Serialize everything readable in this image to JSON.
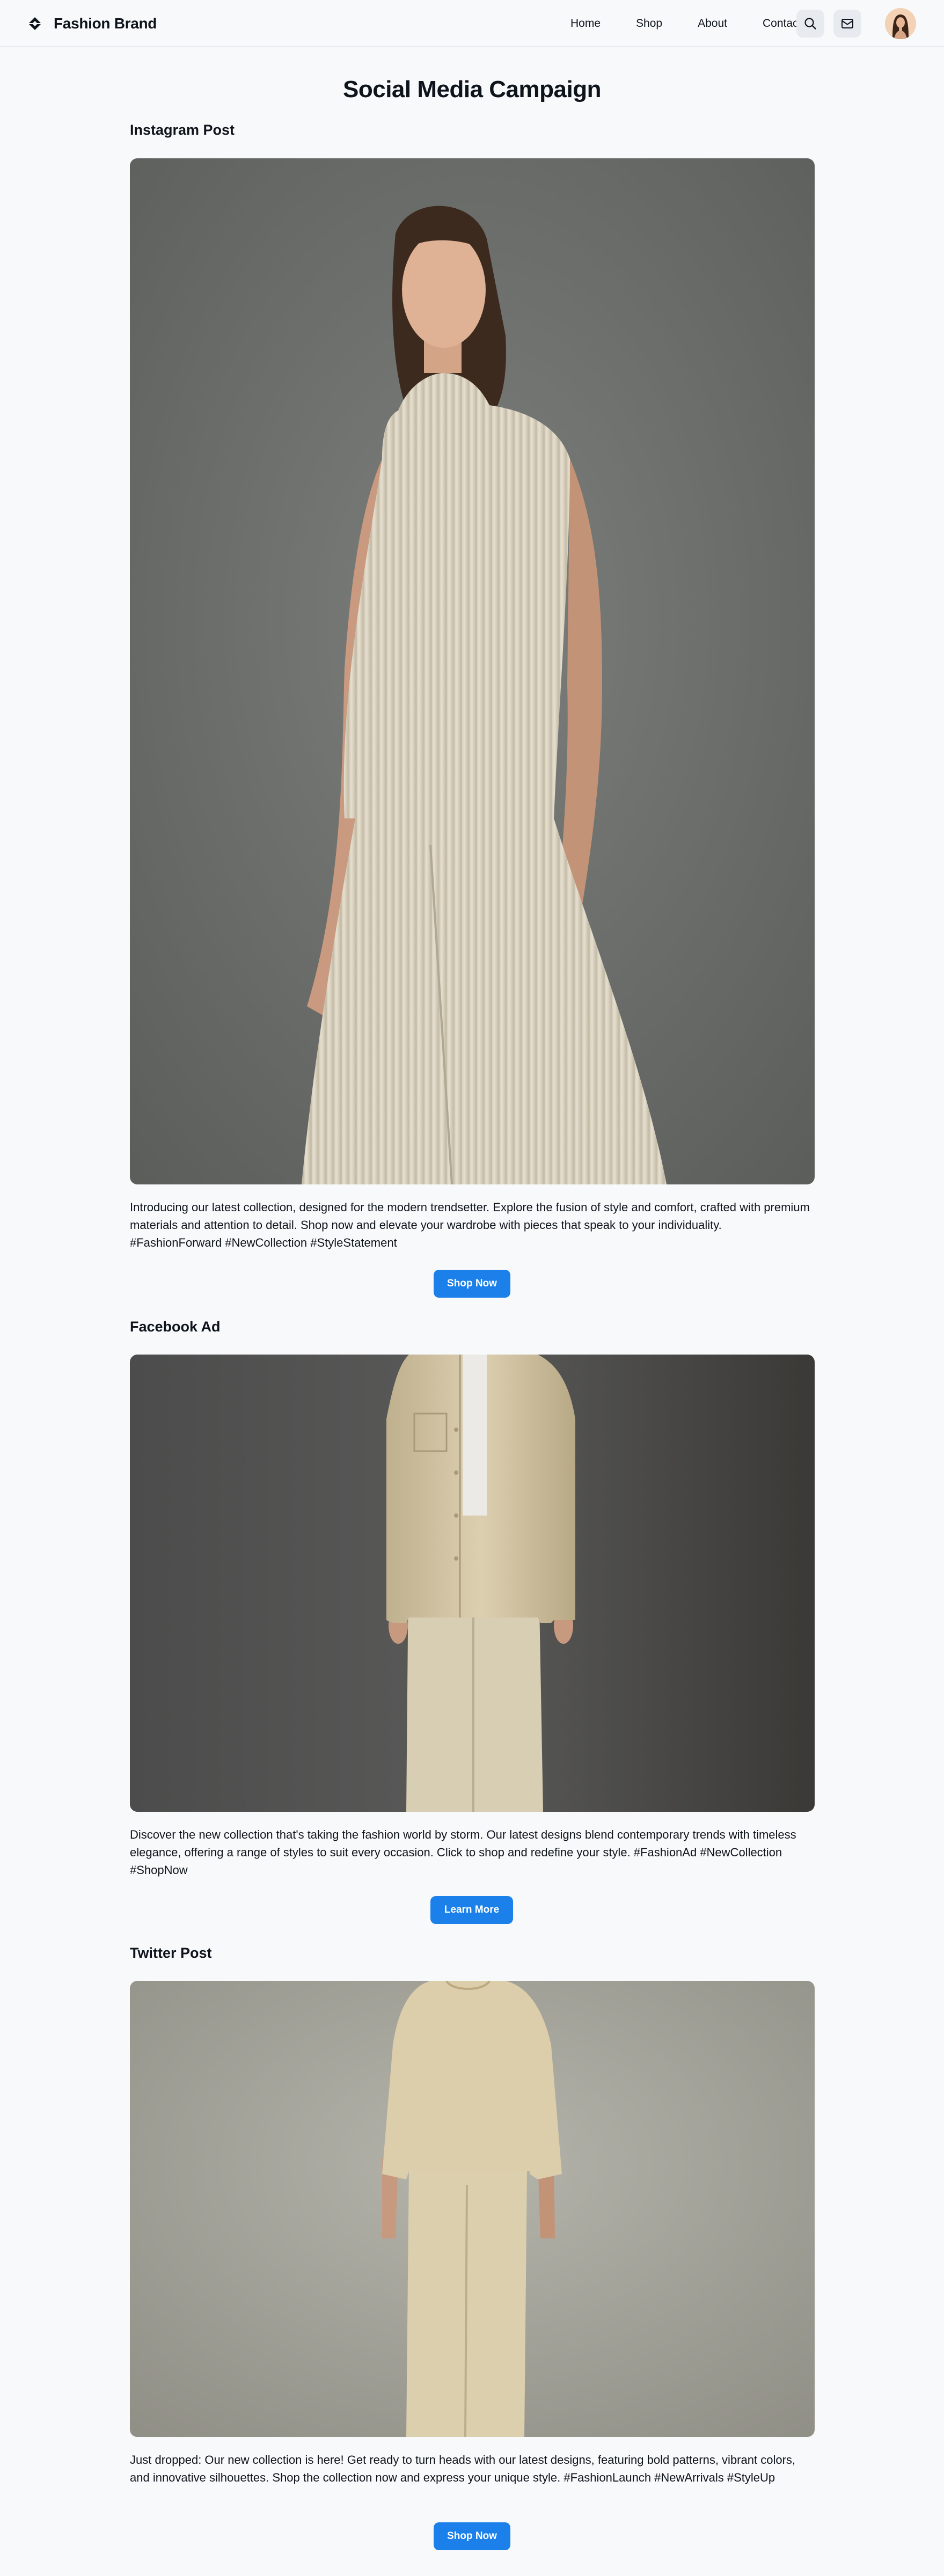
{
  "header": {
    "brand_name": "Fashion Brand",
    "brand_icon": "diamond-logo-icon",
    "nav": [
      {
        "label": "Home"
      },
      {
        "label": "Shop"
      },
      {
        "label": "About"
      },
      {
        "label": "Contact"
      }
    ],
    "search_icon": "search-icon",
    "mail_icon": "mail-icon"
  },
  "main": {
    "title": "Social Media Campaign",
    "sections": [
      {
        "heading": "Instagram Post",
        "image": "model in cream sleeveless ribbed knit top and wide-leg trousers",
        "caption": "Introducing our latest collection, designed for the modern trendsetter. Explore the fusion of style and comfort, crafted with premium materials and attention to detail. Shop now and elevate your wardrobe with pieces that speak to your individuality. #FashionForward #NewCollection #StyleStatement",
        "button": "Shop Now"
      },
      {
        "heading": "Facebook Ad",
        "image": "model in beige button-up overshirt and trousers",
        "caption": "Discover the new collection that's taking the fashion world by storm. Our latest designs blend contemporary trends with timeless elegance, offering a range of styles to suit every occasion. Click to shop and redefine your style. #FashionAd #NewCollection #ShopNow",
        "button": "Learn More"
      },
      {
        "heading": "Twitter Post",
        "image": "model in beige t-shirt and straight trousers",
        "caption": "Just dropped: Our new collection is here! Get ready to turn heads with our latest designs, featuring bold patterns, vibrant colors, and innovative silhouettes. Shop the collection now and express your unique style. #FashionLaunch #NewArrivals #StyleUp",
        "button": "Shop Now"
      }
    ]
  },
  "colors": {
    "background": "#f8f9fb",
    "accent": "#1b80ea",
    "icon_button_bg": "#e7ebf0",
    "text": "#0e141b"
  }
}
